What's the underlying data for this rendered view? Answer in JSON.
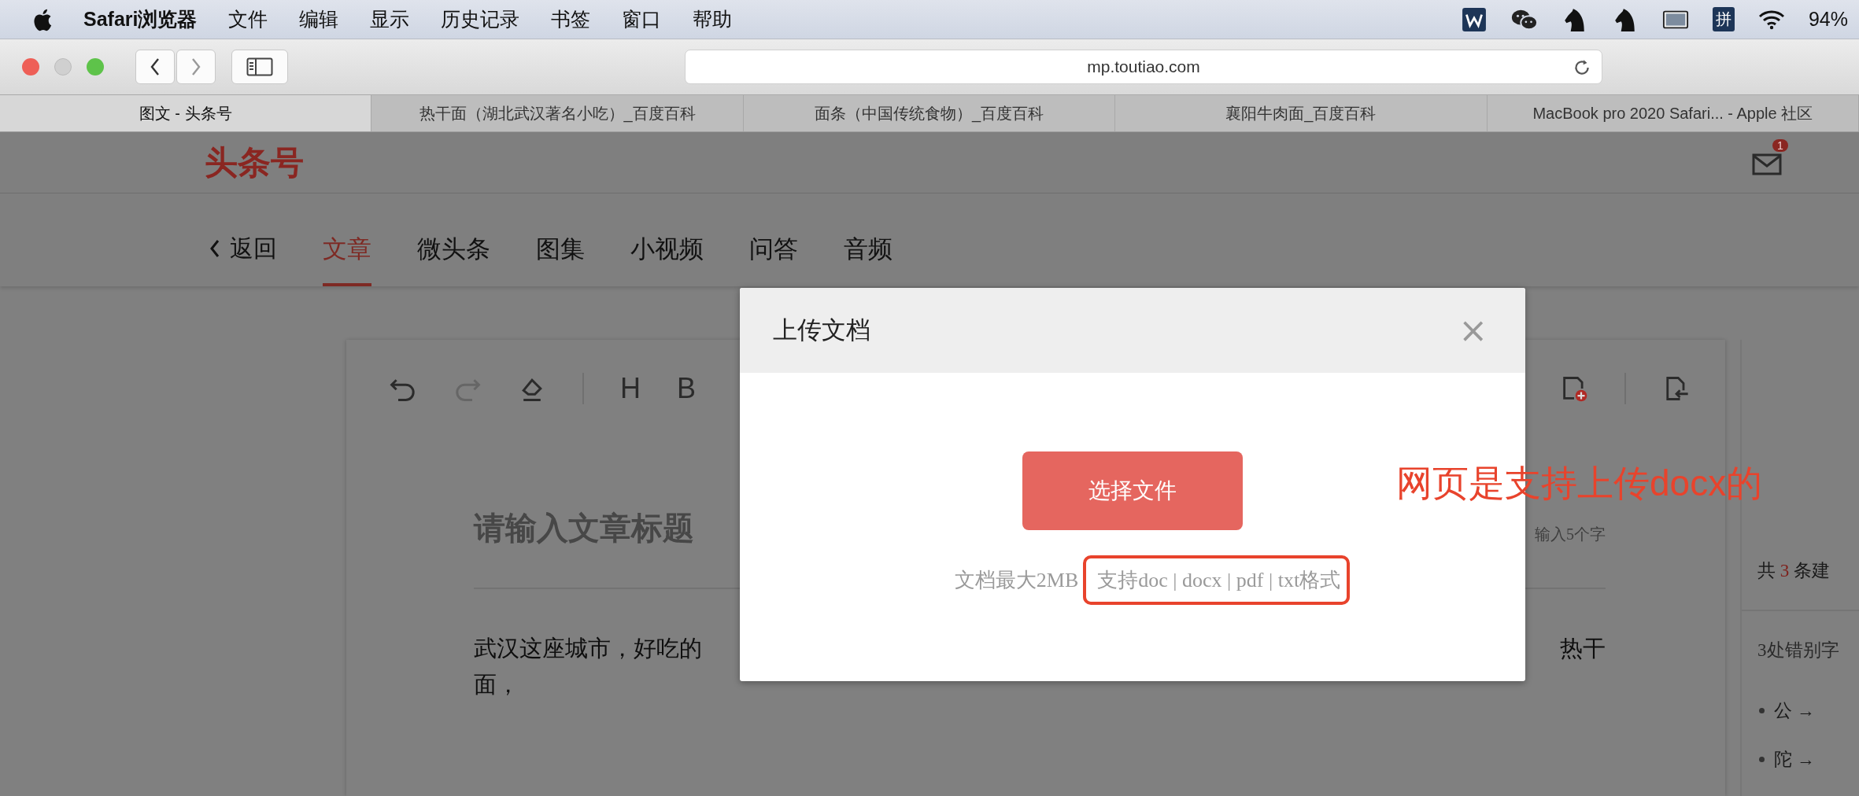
{
  "menubar": {
    "app": "Safari浏览器",
    "items": [
      "文件",
      "编辑",
      "显示",
      "历史记录",
      "书签",
      "窗口",
      "帮助"
    ],
    "input_method": "拼",
    "battery": "94%"
  },
  "browser": {
    "url": "mp.toutiao.com",
    "tabs": [
      {
        "title": "图文 - 头条号",
        "selected": true
      },
      {
        "title": "热干面（湖北武汉著名小吃）_百度百科",
        "selected": false
      },
      {
        "title": "面条（中国传统食物）_百度百科",
        "selected": false
      },
      {
        "title": "襄阳牛肉面_百度百科",
        "selected": false
      },
      {
        "title": "MacBook pro 2020 Safari... - Apple 社区",
        "selected": false
      }
    ]
  },
  "site": {
    "logo": "头条号",
    "badge": "1",
    "back": "返回",
    "nav": [
      {
        "label": "文章",
        "selected": true
      },
      {
        "label": "微头条",
        "selected": false
      },
      {
        "label": "图集",
        "selected": false
      },
      {
        "label": "小视频",
        "selected": false
      },
      {
        "label": "问答",
        "selected": false
      },
      {
        "label": "音频",
        "selected": false
      }
    ]
  },
  "editor": {
    "tools": [
      "H",
      "B"
    ],
    "title_placeholder": "请输入文章标题",
    "counter": "输入5个字",
    "body_line_1_left": "武汉这座城市，好吃的",
    "body_line_1_right": "热干",
    "body_line_2": "面，"
  },
  "suggestions": {
    "summary_prefix": "共",
    "count": "3",
    "summary_suffix": "条建",
    "typo_heading": "3处错别字",
    "items": [
      "公 →",
      "陀 →"
    ]
  },
  "dialog": {
    "title": "上传文档",
    "close": "×",
    "button": "选择文件",
    "size_note": "文档最大2MB",
    "formats_note": "支持doc | docx | pdf | txt格式"
  },
  "annotation": {
    "text": "网页是支持上传docx的"
  }
}
